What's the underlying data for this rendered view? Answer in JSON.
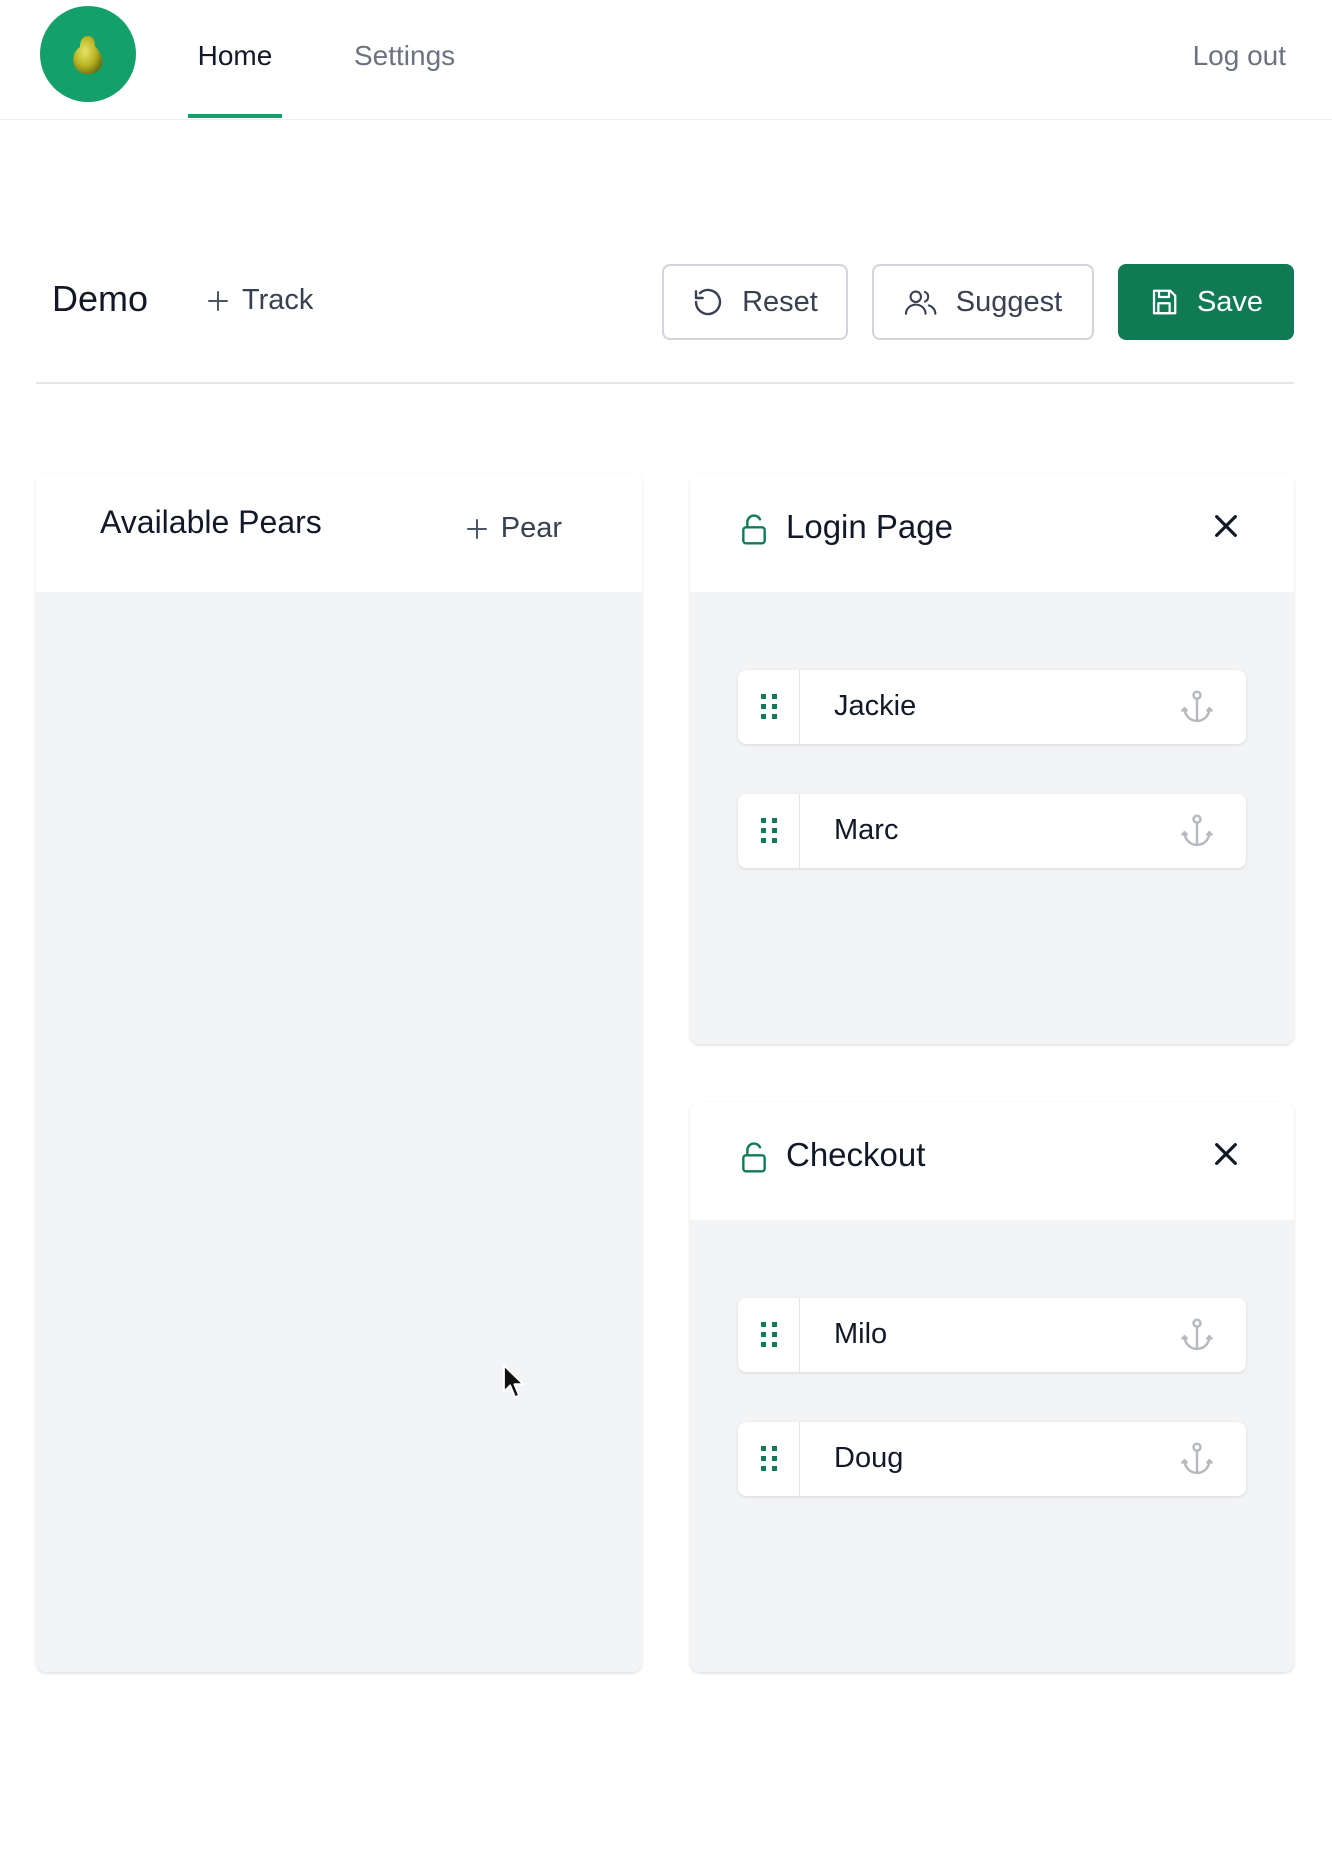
{
  "nav": {
    "tabs": [
      {
        "label": "Home",
        "active": true
      },
      {
        "label": "Settings",
        "active": false
      }
    ],
    "logout_label": "Log out"
  },
  "toolbar": {
    "title": "Demo",
    "add_track_label": "Track",
    "reset_label": "Reset",
    "suggest_label": "Suggest",
    "save_label": "Save"
  },
  "pool": {
    "title": "Available Pears",
    "add_pear_label": "Pear",
    "pears": []
  },
  "tracks": [
    {
      "title": "Login Page",
      "pears": [
        "Jackie",
        "Marc"
      ]
    },
    {
      "title": "Checkout",
      "pears": [
        "Milo",
        "Doug"
      ]
    }
  ],
  "colors": {
    "brand": "#14a06a",
    "save_button": "#0f7a53",
    "panel_bg": "#f3f4f6"
  },
  "icons": {
    "logo": "pear-logo-icon",
    "add": "plus-icon",
    "reset": "rotate-ccw-icon",
    "suggest": "users-icon",
    "save": "save-icon",
    "lock": "unlock-icon",
    "close": "close-icon",
    "grip": "drag-handle-icon",
    "anchor": "anchor-icon"
  }
}
